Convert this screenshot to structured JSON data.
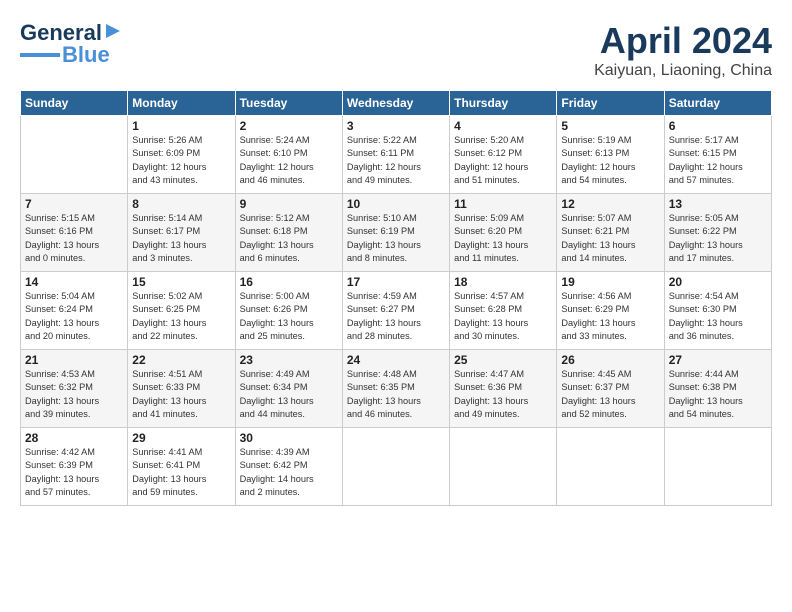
{
  "logo": {
    "line1": "General",
    "line2": "Blue"
  },
  "title": "April 2024",
  "subtitle": "Kaiyuan, Liaoning, China",
  "weekdays": [
    "Sunday",
    "Monday",
    "Tuesday",
    "Wednesday",
    "Thursday",
    "Friday",
    "Saturday"
  ],
  "weeks": [
    [
      {
        "day": "",
        "info": ""
      },
      {
        "day": "1",
        "info": "Sunrise: 5:26 AM\nSunset: 6:09 PM\nDaylight: 12 hours\nand 43 minutes."
      },
      {
        "day": "2",
        "info": "Sunrise: 5:24 AM\nSunset: 6:10 PM\nDaylight: 12 hours\nand 46 minutes."
      },
      {
        "day": "3",
        "info": "Sunrise: 5:22 AM\nSunset: 6:11 PM\nDaylight: 12 hours\nand 49 minutes."
      },
      {
        "day": "4",
        "info": "Sunrise: 5:20 AM\nSunset: 6:12 PM\nDaylight: 12 hours\nand 51 minutes."
      },
      {
        "day": "5",
        "info": "Sunrise: 5:19 AM\nSunset: 6:13 PM\nDaylight: 12 hours\nand 54 minutes."
      },
      {
        "day": "6",
        "info": "Sunrise: 5:17 AM\nSunset: 6:15 PM\nDaylight: 12 hours\nand 57 minutes."
      }
    ],
    [
      {
        "day": "7",
        "info": "Sunrise: 5:15 AM\nSunset: 6:16 PM\nDaylight: 13 hours\nand 0 minutes."
      },
      {
        "day": "8",
        "info": "Sunrise: 5:14 AM\nSunset: 6:17 PM\nDaylight: 13 hours\nand 3 minutes."
      },
      {
        "day": "9",
        "info": "Sunrise: 5:12 AM\nSunset: 6:18 PM\nDaylight: 13 hours\nand 6 minutes."
      },
      {
        "day": "10",
        "info": "Sunrise: 5:10 AM\nSunset: 6:19 PM\nDaylight: 13 hours\nand 8 minutes."
      },
      {
        "day": "11",
        "info": "Sunrise: 5:09 AM\nSunset: 6:20 PM\nDaylight: 13 hours\nand 11 minutes."
      },
      {
        "day": "12",
        "info": "Sunrise: 5:07 AM\nSunset: 6:21 PM\nDaylight: 13 hours\nand 14 minutes."
      },
      {
        "day": "13",
        "info": "Sunrise: 5:05 AM\nSunset: 6:22 PM\nDaylight: 13 hours\nand 17 minutes."
      }
    ],
    [
      {
        "day": "14",
        "info": "Sunrise: 5:04 AM\nSunset: 6:24 PM\nDaylight: 13 hours\nand 20 minutes."
      },
      {
        "day": "15",
        "info": "Sunrise: 5:02 AM\nSunset: 6:25 PM\nDaylight: 13 hours\nand 22 minutes."
      },
      {
        "day": "16",
        "info": "Sunrise: 5:00 AM\nSunset: 6:26 PM\nDaylight: 13 hours\nand 25 minutes."
      },
      {
        "day": "17",
        "info": "Sunrise: 4:59 AM\nSunset: 6:27 PM\nDaylight: 13 hours\nand 28 minutes."
      },
      {
        "day": "18",
        "info": "Sunrise: 4:57 AM\nSunset: 6:28 PM\nDaylight: 13 hours\nand 30 minutes."
      },
      {
        "day": "19",
        "info": "Sunrise: 4:56 AM\nSunset: 6:29 PM\nDaylight: 13 hours\nand 33 minutes."
      },
      {
        "day": "20",
        "info": "Sunrise: 4:54 AM\nSunset: 6:30 PM\nDaylight: 13 hours\nand 36 minutes."
      }
    ],
    [
      {
        "day": "21",
        "info": "Sunrise: 4:53 AM\nSunset: 6:32 PM\nDaylight: 13 hours\nand 39 minutes."
      },
      {
        "day": "22",
        "info": "Sunrise: 4:51 AM\nSunset: 6:33 PM\nDaylight: 13 hours\nand 41 minutes."
      },
      {
        "day": "23",
        "info": "Sunrise: 4:49 AM\nSunset: 6:34 PM\nDaylight: 13 hours\nand 44 minutes."
      },
      {
        "day": "24",
        "info": "Sunrise: 4:48 AM\nSunset: 6:35 PM\nDaylight: 13 hours\nand 46 minutes."
      },
      {
        "day": "25",
        "info": "Sunrise: 4:47 AM\nSunset: 6:36 PM\nDaylight: 13 hours\nand 49 minutes."
      },
      {
        "day": "26",
        "info": "Sunrise: 4:45 AM\nSunset: 6:37 PM\nDaylight: 13 hours\nand 52 minutes."
      },
      {
        "day": "27",
        "info": "Sunrise: 4:44 AM\nSunset: 6:38 PM\nDaylight: 13 hours\nand 54 minutes."
      }
    ],
    [
      {
        "day": "28",
        "info": "Sunrise: 4:42 AM\nSunset: 6:39 PM\nDaylight: 13 hours\nand 57 minutes."
      },
      {
        "day": "29",
        "info": "Sunrise: 4:41 AM\nSunset: 6:41 PM\nDaylight: 13 hours\nand 59 minutes."
      },
      {
        "day": "30",
        "info": "Sunrise: 4:39 AM\nSunset: 6:42 PM\nDaylight: 14 hours\nand 2 minutes."
      },
      {
        "day": "",
        "info": ""
      },
      {
        "day": "",
        "info": ""
      },
      {
        "day": "",
        "info": ""
      },
      {
        "day": "",
        "info": ""
      }
    ]
  ]
}
